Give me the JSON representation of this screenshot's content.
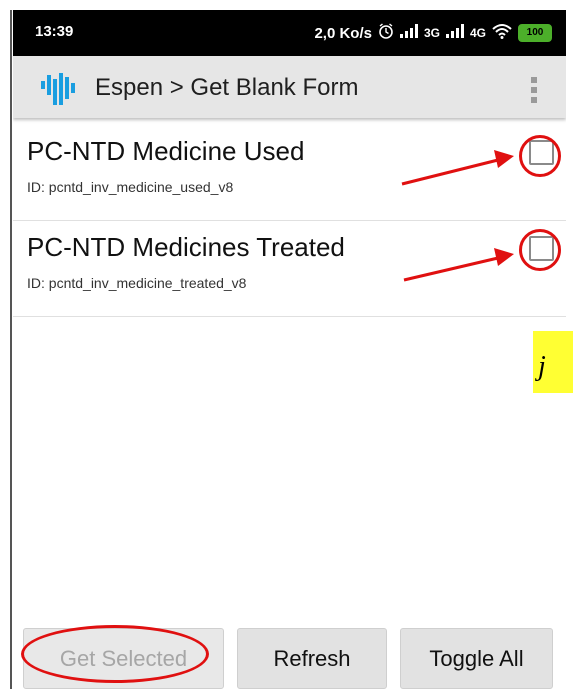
{
  "status_bar": {
    "time": "13:39",
    "network_speed": "2,0 Ko/s",
    "alarm_icon": "alarm-icon",
    "signal_1": "3G",
    "signal_2": "4G",
    "wifi_icon": "wifi-icon",
    "battery": "100"
  },
  "app_bar": {
    "logo_icon": "espen-logo-icon",
    "title": "Espen > Get Blank Form",
    "menu_icon": "overflow-menu-icon"
  },
  "forms": [
    {
      "title": "PC-NTD Medicine Used",
      "id_text": "ID: pcntd_inv_medicine_used_v8",
      "checked": false
    },
    {
      "title": "PC-NTD Medicines Treated",
      "id_text": "ID: pcntd_inv_medicine_treated_v8",
      "checked": false
    }
  ],
  "annotation": {
    "note_fragment": "j",
    "color": "#e01010",
    "highlight": "#ffff33"
  },
  "buttons": {
    "get_selected": "Get Selected",
    "get_selected_enabled": false,
    "refresh": "Refresh",
    "toggle_all": "Toggle All"
  }
}
